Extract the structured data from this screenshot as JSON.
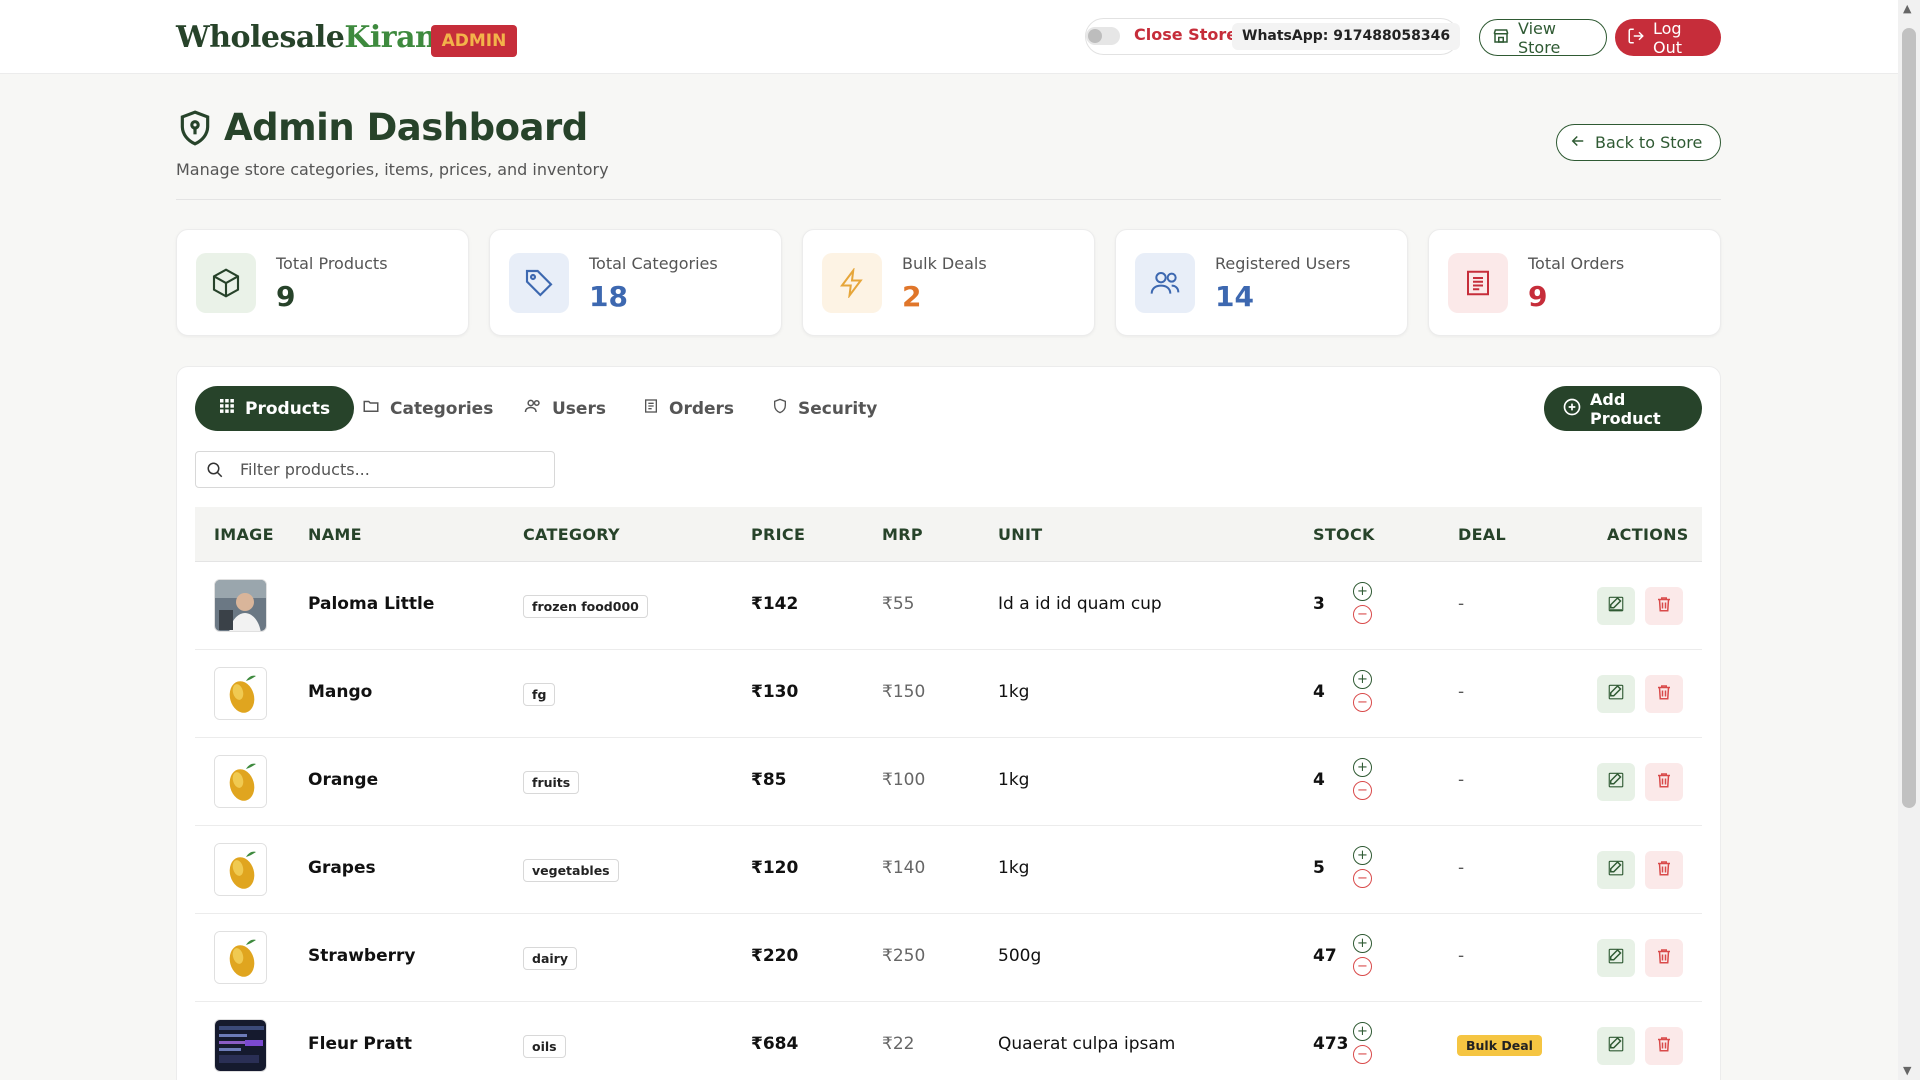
{
  "header": {
    "brand_part1": "Wholesale",
    "brand_part2": "Kirana",
    "admin_badge": "ADMIN",
    "close_store": "Close Store",
    "whatsapp": "WhatsApp: 917488058346",
    "view_store": "View Store",
    "logout": "Log Out"
  },
  "page": {
    "title": "Admin Dashboard",
    "subtitle": "Manage store categories, items, prices, and inventory",
    "back_to_store": "Back to Store"
  },
  "stats": [
    {
      "label": "Total Products",
      "value": "9",
      "color": "#27432a",
      "icon": "box-icon"
    },
    {
      "label": "Total Categories",
      "value": "18",
      "color": "#3d68b0",
      "icon": "tag-icon"
    },
    {
      "label": "Bulk Deals",
      "value": "2",
      "color": "#e0762a",
      "icon": "lightning-icon"
    },
    {
      "label": "Registered Users",
      "value": "14",
      "color": "#3d68b0",
      "icon": "users-icon"
    },
    {
      "label": "Total Orders",
      "value": "9",
      "color": "#c62d3a",
      "icon": "receipt-icon"
    }
  ],
  "tabs": {
    "products": "Products",
    "categories": "Categories",
    "users": "Users",
    "orders": "Orders",
    "security": "Security"
  },
  "add_product": "Add Product",
  "search": {
    "placeholder": "Filter products..."
  },
  "table": {
    "headers": {
      "image": "IMAGE",
      "name": "NAME",
      "category": "CATEGORY",
      "price": "PRICE",
      "mrp": "MRP",
      "unit": "UNIT",
      "stock": "STOCK",
      "deal": "DEAL",
      "actions": "ACTIONS"
    },
    "rows": [
      {
        "name": "Paloma Little",
        "category": "frozen food000",
        "price": "₹142",
        "mrp": "₹55",
        "unit": "Id a id id quam cup",
        "stock": "3",
        "deal": "-"
      },
      {
        "name": "Mango",
        "category": "fg",
        "price": "₹130",
        "mrp": "₹150",
        "unit": "1kg",
        "stock": "4",
        "deal": "-"
      },
      {
        "name": "Orange",
        "category": "fruits",
        "price": "₹85",
        "mrp": "₹100",
        "unit": "1kg",
        "stock": "4",
        "deal": "-"
      },
      {
        "name": "Grapes",
        "category": "vegetables",
        "price": "₹120",
        "mrp": "₹140",
        "unit": "1kg",
        "stock": "5",
        "deal": "-"
      },
      {
        "name": "Strawberry",
        "category": "dairy",
        "price": "₹220",
        "mrp": "₹250",
        "unit": "500g",
        "stock": "47",
        "deal": "-"
      },
      {
        "name": "Fleur Pratt",
        "category": "oils",
        "price": "₹684",
        "mrp": "₹22",
        "unit": "Quaerat culpa ipsam",
        "stock": "473",
        "deal": "Bulk Deal"
      }
    ],
    "stock_plus": "+",
    "stock_minus": "−"
  }
}
